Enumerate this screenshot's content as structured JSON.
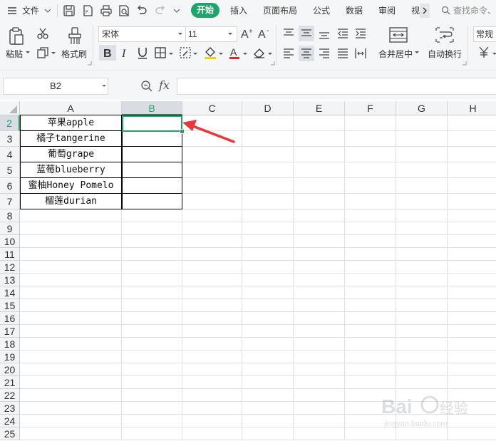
{
  "menu": {
    "file": "文件",
    "tabs": [
      "开始",
      "插入",
      "页面布局",
      "公式",
      "数据",
      "审阅",
      "视"
    ],
    "search_placeholder": "查找命令、"
  },
  "ribbon": {
    "paste": "粘贴",
    "format_painter": "格式刷",
    "font_name": "宋体",
    "font_size": "11",
    "merge_center": "合并居中",
    "wrap_text": "自动换行",
    "number_format": "常规"
  },
  "formula_bar": {
    "cell_ref": "B2",
    "fx": "fx",
    "content": ""
  },
  "sheet": {
    "columns": [
      "A",
      "B",
      "C",
      "D",
      "E",
      "F",
      "G",
      "H"
    ],
    "rows": [
      "2",
      "3",
      "4",
      "5",
      "6",
      "7",
      "8",
      "9",
      "10",
      "11",
      "12",
      "13",
      "14",
      "15",
      "16",
      "17",
      "18",
      "19",
      "20",
      "21",
      "22",
      "23",
      "24",
      "25"
    ],
    "active_column": "B",
    "active_row": "2",
    "column_a_values": [
      "苹果apple",
      "橘子tangerine",
      "葡萄grape",
      "蓝莓blueberry",
      "蜜柚Honey Pomelo",
      "榴莲durian"
    ],
    "selected_cell_value": ""
  },
  "colors": {
    "accent": "#1fa56a",
    "arrow": "#e8363a",
    "selection": "#21a366"
  }
}
